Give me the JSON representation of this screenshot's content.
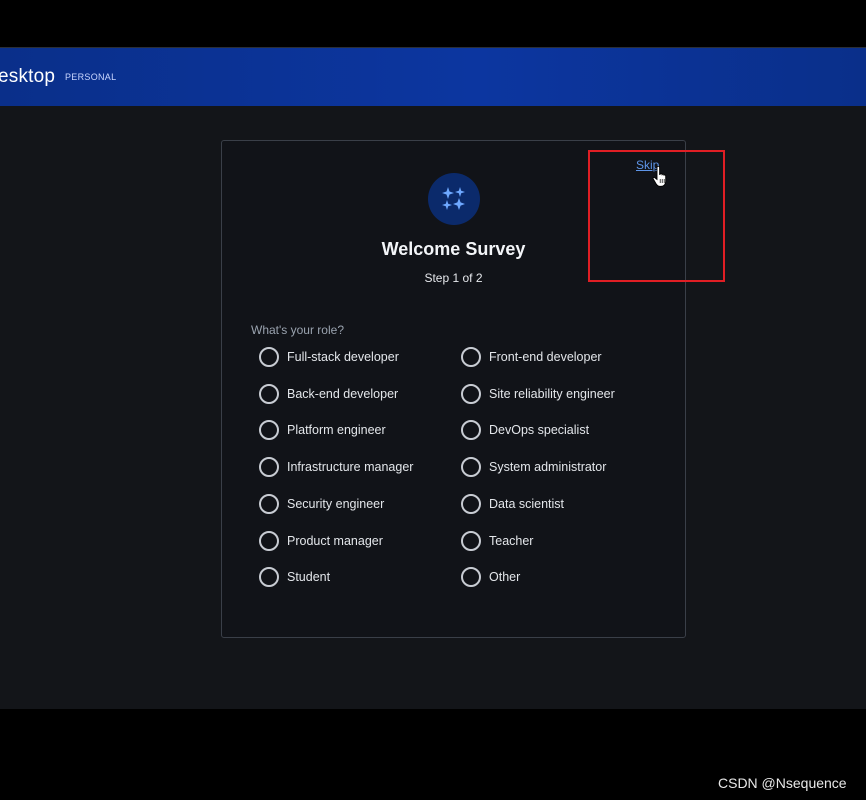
{
  "app": {
    "brand_name": "esktop",
    "brand_badge": "PERSONAL",
    "topbar_color": "#0c36a0"
  },
  "survey": {
    "icon": "sparkles-icon",
    "skip_label": "Skip",
    "title": "Welcome Survey",
    "step": "Step 1 of 2",
    "question": "What's your role?",
    "options_left": [
      "Full-stack developer",
      "Back-end developer",
      "Platform engineer",
      "Infrastructure manager",
      "Security engineer",
      "Product manager",
      "Student"
    ],
    "options_right": [
      "Front-end developer",
      "Site reliability engineer",
      "DevOps specialist",
      "System administrator",
      "Data scientist",
      "Teacher",
      "Other"
    ]
  },
  "annotation": {
    "highlight_color": "#e01e24"
  },
  "watermark": "CSDN @Nsequence"
}
